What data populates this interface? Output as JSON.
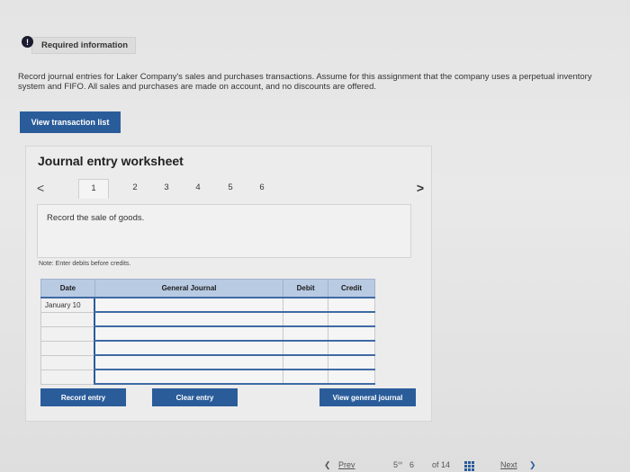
{
  "header": {
    "alert_icon": "!",
    "required_label": "Required information"
  },
  "instructions": "Record journal entries for Laker Company's sales and purchases transactions. Assume for this assignment that the company uses a perpetual inventory system and FIFO. All sales and purchases are made on account, and no discounts are offered.",
  "view_transaction_button": "View transaction list",
  "worksheet": {
    "title": "Journal entry worksheet",
    "prev_glyph": "<",
    "next_glyph": ">",
    "tabs": [
      "1",
      "2",
      "3",
      "4",
      "5",
      "6"
    ],
    "active_tab": "1",
    "description": "Record the sale of goods.",
    "note": "Note: Enter debits before credits.",
    "table": {
      "headers": [
        "Date",
        "General Journal",
        "Debit",
        "Credit"
      ],
      "rows": [
        {
          "date": "January 10",
          "account": "",
          "debit": "",
          "credit": ""
        },
        {
          "date": "",
          "account": "",
          "debit": "",
          "credit": ""
        },
        {
          "date": "",
          "account": "",
          "debit": "",
          "credit": ""
        },
        {
          "date": "",
          "account": "",
          "debit": "",
          "credit": ""
        },
        {
          "date": "",
          "account": "",
          "debit": "",
          "credit": ""
        },
        {
          "date": "",
          "account": "",
          "debit": "",
          "credit": ""
        }
      ]
    },
    "buttons": {
      "record": "Record entry",
      "clear": "Clear entry",
      "view_journal": "View general journal"
    }
  },
  "footer": {
    "prev_label": "Prev",
    "page_a": "5",
    "page_b": "6",
    "of_total": "of 14",
    "next_label": "Next"
  },
  "icons": {
    "alert": "alert-icon",
    "link": "link-icon",
    "grid": "grid-icon"
  },
  "colors": {
    "button_blue": "#2a5c9a",
    "table_header": "#b9cbe3"
  }
}
